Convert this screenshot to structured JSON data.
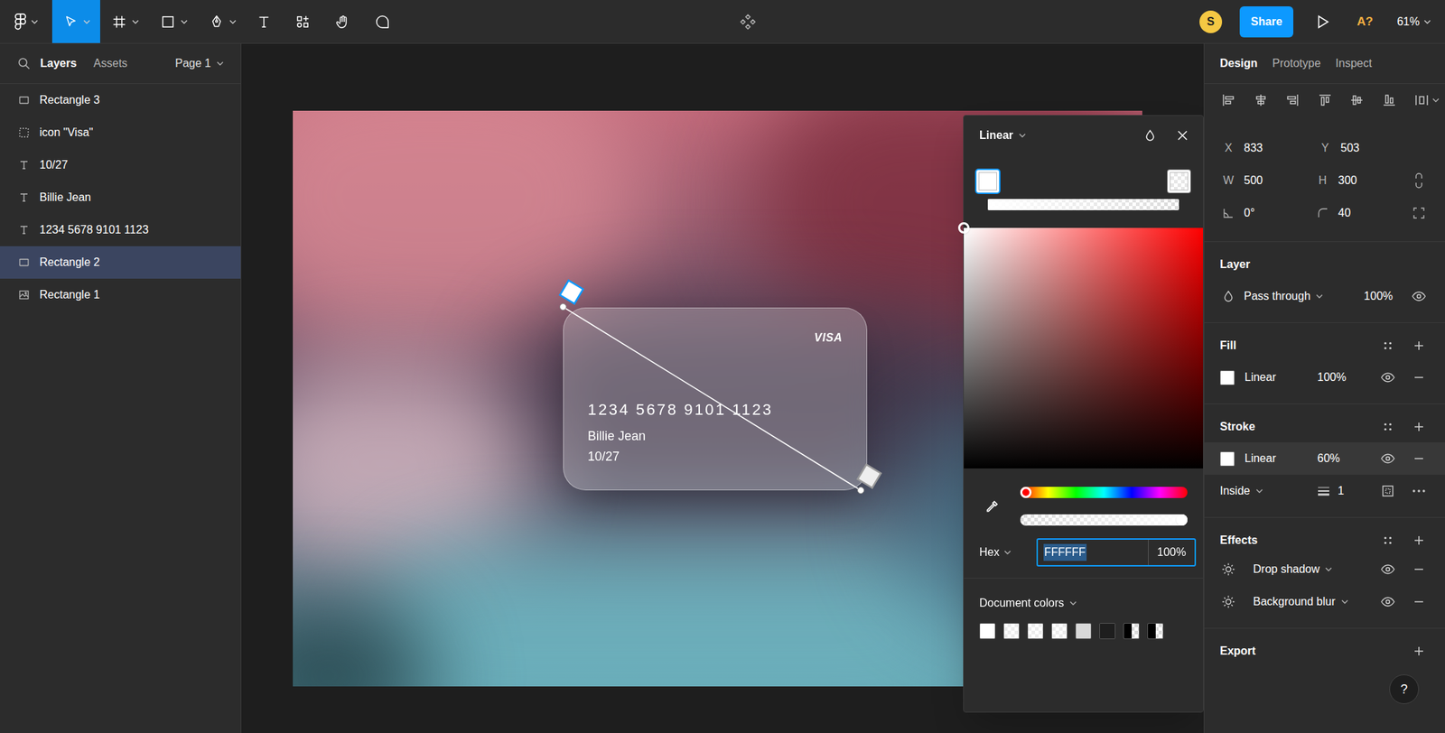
{
  "toolbar": {
    "tools": [
      {
        "selected": false
      },
      {
        "selected": true
      },
      {
        "selected": false
      },
      {
        "selected": false
      },
      {
        "selected": false
      },
      {
        "selected": false
      },
      {
        "selected": false
      },
      {
        "selected": false
      },
      {
        "selected": false
      }
    ],
    "avatar": "S",
    "share": "Share",
    "ai": "A?",
    "zoom": "61%"
  },
  "left_panel": {
    "tabs": [
      {
        "label": "Layers",
        "selected": true
      },
      {
        "label": "Assets",
        "selected": false
      }
    ],
    "page": "Page 1",
    "layers": [
      {
        "name": "Rectangle 3",
        "kind": "rectangle",
        "selected": false
      },
      {
        "name": "icon \"Visa\"",
        "kind": "frame",
        "selected": false
      },
      {
        "name": "10/27",
        "kind": "text",
        "selected": false
      },
      {
        "name": "Billie Jean",
        "kind": "text",
        "selected": false
      },
      {
        "name": "1234 5678 9101 1123",
        "kind": "text",
        "selected": false
      },
      {
        "name": "Rectangle 2",
        "kind": "rectangle",
        "selected": true
      },
      {
        "name": "Rectangle 1",
        "kind": "image",
        "selected": false
      }
    ]
  },
  "canvas": {
    "card": {
      "brand": "VISA",
      "number": "1234 5678 9101 1123",
      "holder": "Billie Jean",
      "expiry": "10/27"
    }
  },
  "color_picker": {
    "type": "Linear",
    "stops": [
      {
        "color": "#FFFFFF",
        "opacity": 1,
        "selected": true
      },
      {
        "color": "#FFFFFF",
        "opacity": 0,
        "selected": false
      }
    ],
    "saturation": 0,
    "brightness": 1,
    "hue_level": 0,
    "alpha_level": 1,
    "format": "Hex",
    "hex": "FFFFFF",
    "opacity": "100%",
    "document_colors": {
      "label": "Document colors",
      "swatches": [
        {
          "color": "#FFFFFF",
          "kind": "solid"
        },
        {
          "color": "#FFFFFF",
          "kind": "translucent"
        },
        {
          "color": "#FFFFFF",
          "kind": "translucent"
        },
        {
          "color": "#FFFFFF",
          "kind": "translucent"
        },
        {
          "color": "#D9D9D9",
          "kind": "solid"
        },
        {
          "color": "#1E1E1E",
          "kind": "solid"
        },
        {
          "color": "#000000",
          "kind": "split"
        },
        {
          "color": "#000000",
          "kind": "split"
        }
      ]
    }
  },
  "right_panel": {
    "tabs": [
      {
        "label": "Design",
        "selected": true
      },
      {
        "label": "Prototype",
        "selected": false
      },
      {
        "label": "Inspect",
        "selected": false
      }
    ],
    "position": [
      {
        "label": "X",
        "value": "833"
      },
      {
        "label": "Y",
        "value": "503"
      }
    ],
    "size": [
      {
        "label": "W",
        "value": "500"
      },
      {
        "label": "H",
        "value": "300"
      }
    ],
    "rotation": "0°",
    "radius": "40",
    "layer": {
      "title": "Layer",
      "blend": "Pass through",
      "opacity": "100%",
      "visible": true
    },
    "fill": {
      "title": "Fill",
      "items": [
        {
          "type": "Linear",
          "opacity": "100%",
          "color": "#FFFFFF",
          "visible": true,
          "highlighted": false
        }
      ]
    },
    "stroke": {
      "title": "Stroke",
      "items": [
        {
          "type": "Linear",
          "opacity": "60%",
          "color": "#FFFFFF",
          "visible": true,
          "highlighted": true
        }
      ],
      "position": "Inside",
      "weight": "1"
    },
    "effects": {
      "title": "Effects",
      "items": [
        {
          "label": "Drop shadow",
          "visible": true
        },
        {
          "label": "Background blur",
          "visible": true
        }
      ]
    },
    "export": {
      "title": "Export"
    },
    "help": "?"
  }
}
